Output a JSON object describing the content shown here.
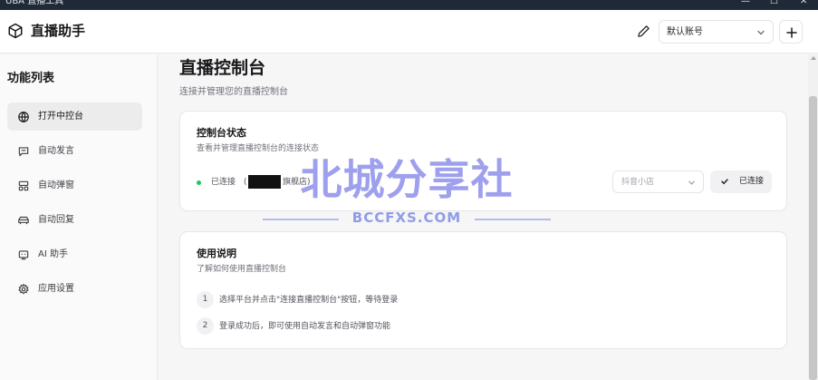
{
  "window": {
    "title": "UBA 直播工具",
    "controls": [
      "—",
      "☐",
      "✕"
    ]
  },
  "header": {
    "app_name": "直播助手",
    "account_value": "默认账号",
    "add_label": "+"
  },
  "sidebar": {
    "title": "功能列表",
    "items": [
      {
        "label": "打开中控台",
        "icon": "globe-icon",
        "active": true
      },
      {
        "label": "自动发言",
        "icon": "message-icon",
        "active": false
      },
      {
        "label": "自动弹窗",
        "icon": "layout-icon",
        "active": false
      },
      {
        "label": "自动回复",
        "icon": "car-icon",
        "active": false
      },
      {
        "label": "AI 助手",
        "icon": "robot-icon",
        "active": false
      },
      {
        "label": "应用设置",
        "icon": "gear-icon",
        "active": false
      }
    ]
  },
  "main": {
    "title": "直播控制台",
    "subtitle": "连接并管理您的直播控制台",
    "status_card": {
      "title": "控制台状态",
      "description": "查看并管理直播控制台的连接状态",
      "status_label": "已连接",
      "open_paren": "(",
      "shop_name": "旗舰店)",
      "platform_value": "抖音小店",
      "connected_label": "已连接"
    },
    "help_card": {
      "title": "使用说明",
      "description": "了解如何使用直播控制台",
      "steps": [
        {
          "num": "1",
          "text": "选择平台并点击\"连接直播控制台\"按钮，等待登录"
        },
        {
          "num": "2",
          "text": "登录成功后，即可使用自动发言和自动弹窗功能"
        }
      ]
    }
  },
  "watermark": {
    "main": "北城分享社",
    "url": "BCCFXS.COM"
  },
  "colors": {
    "status_dot": "#22c55e",
    "active_item": "#ececed",
    "watermark": "#787ce6"
  }
}
